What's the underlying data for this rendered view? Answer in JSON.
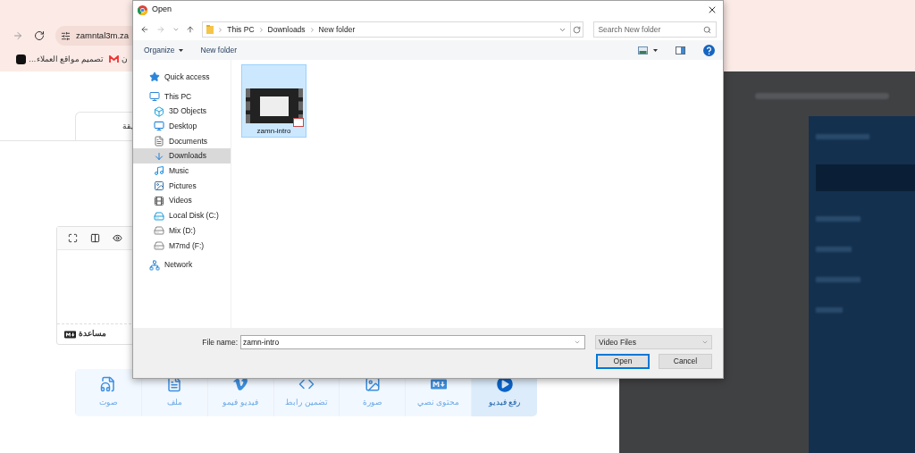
{
  "browser": {
    "address": "zamntal3m.za",
    "bookmarks": [
      {
        "kind": "mail",
        "label": "ن"
      },
      {
        "kind": "app",
        "label": "تصميم مواقع العملاء…"
      }
    ]
  },
  "page": {
    "tab_label": "يقة",
    "editor": {
      "help_label": "مساعدة"
    },
    "insert_buttons": [
      {
        "kind": "upload",
        "label": "رفع فيديو",
        "selected": true
      },
      {
        "kind": "markdown",
        "label": "محتوى نصي",
        "selected": false
      },
      {
        "kind": "image",
        "label": "صورة",
        "selected": false
      },
      {
        "kind": "embed",
        "label": "تضمين رابط",
        "selected": false
      },
      {
        "kind": "vimeo",
        "label": "فيديو فيمو",
        "selected": false
      },
      {
        "kind": "file",
        "label": "ملف",
        "selected": false
      },
      {
        "kind": "audio",
        "label": "صوت",
        "selected": false
      }
    ]
  },
  "dialog": {
    "title": "Open",
    "breadcrumbs": [
      "This PC",
      "Downloads",
      "New folder"
    ],
    "search": {
      "placeholder": "Search New folder"
    },
    "commands": [
      {
        "label": "Organize",
        "dropdown": true
      },
      {
        "label": "New folder",
        "dropdown": false
      }
    ],
    "nav": [
      {
        "label": "Quick access",
        "selected": false
      },
      {
        "label": "This PC",
        "selected": false,
        "children": [
          {
            "label": "3D Objects",
            "selected": false
          },
          {
            "label": "Desktop",
            "selected": false
          },
          {
            "label": "Documents",
            "selected": false
          },
          {
            "label": "Downloads",
            "selected": true
          },
          {
            "label": "Music",
            "selected": false
          },
          {
            "label": "Pictures",
            "selected": false
          },
          {
            "label": "Videos",
            "selected": false
          },
          {
            "label": "Local Disk (C:)",
            "selected": false
          },
          {
            "label": "Mix (D:)",
            "selected": false
          },
          {
            "label": "M7md (F:)",
            "selected": false
          }
        ]
      },
      {
        "label": "Network",
        "selected": false
      }
    ],
    "files": [
      {
        "name": "zamn-intro",
        "selected": true
      }
    ],
    "file_name_label": "File name:",
    "file_name": "zamn-intro",
    "file_type": "Video Files",
    "buttons": [
      {
        "label": "Open",
        "default": true
      },
      {
        "label": "Cancel",
        "default": false
      }
    ]
  }
}
